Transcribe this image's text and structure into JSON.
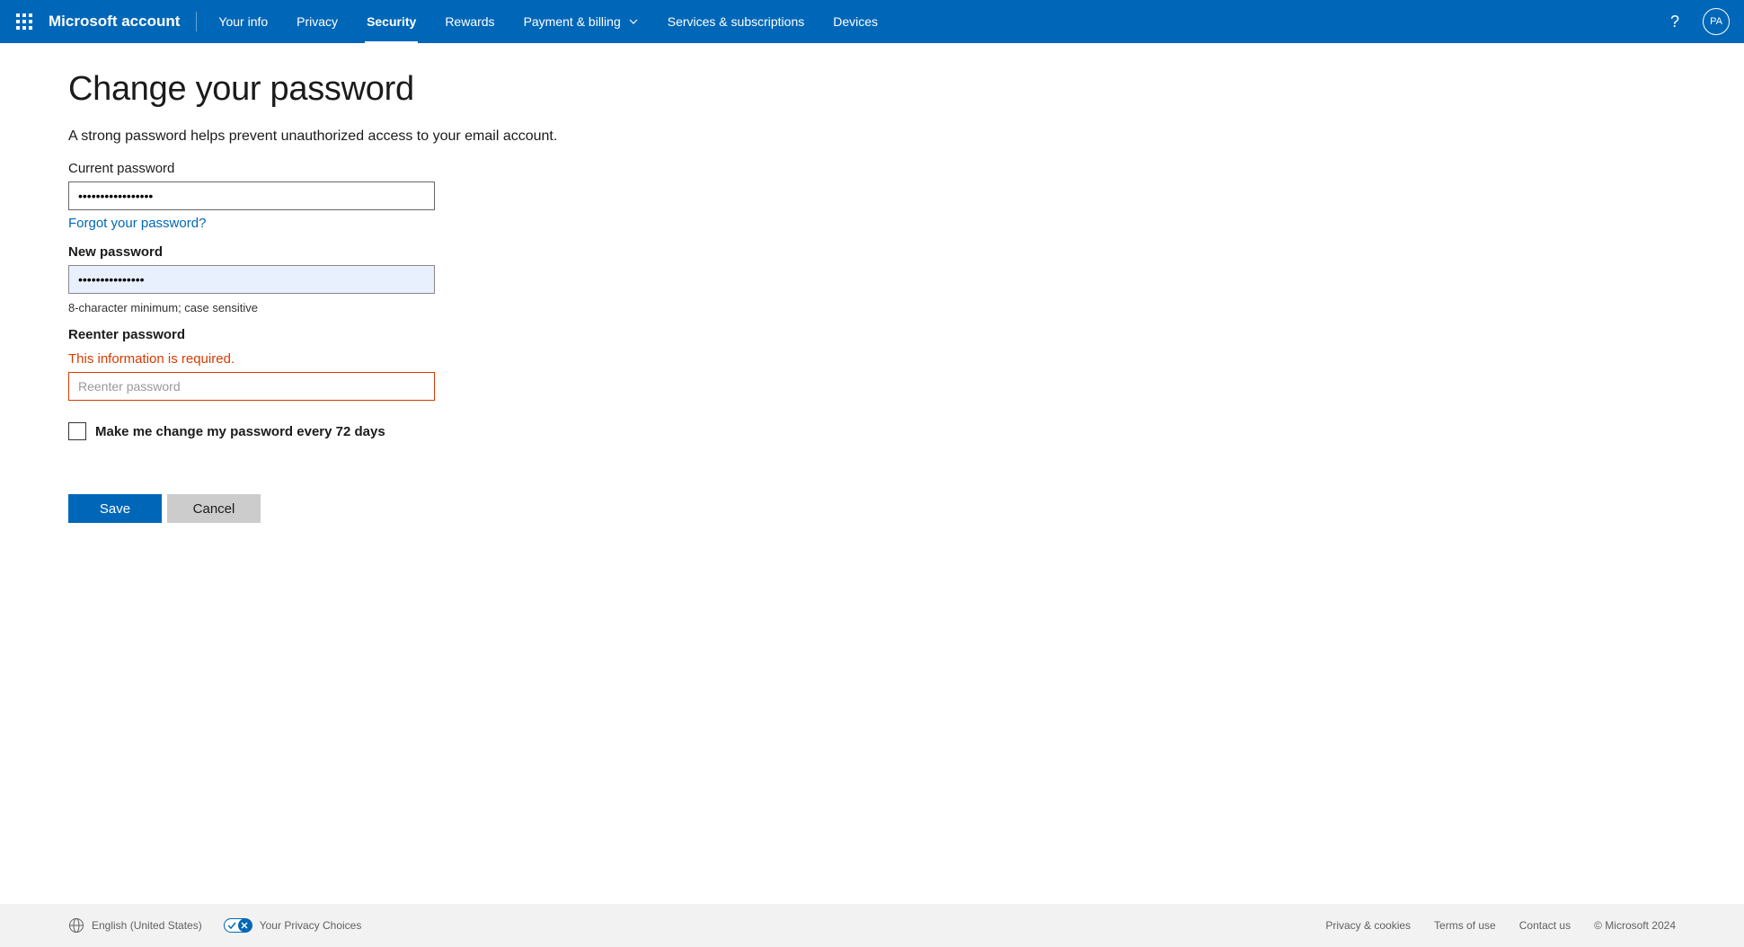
{
  "header": {
    "brand": "Microsoft account",
    "nav": [
      {
        "label": "Your info",
        "active": false,
        "hasDropdown": false
      },
      {
        "label": "Privacy",
        "active": false,
        "hasDropdown": false
      },
      {
        "label": "Security",
        "active": true,
        "hasDropdown": false
      },
      {
        "label": "Rewards",
        "active": false,
        "hasDropdown": false
      },
      {
        "label": "Payment & billing",
        "active": false,
        "hasDropdown": true
      },
      {
        "label": "Services & subscriptions",
        "active": false,
        "hasDropdown": false
      },
      {
        "label": "Devices",
        "active": false,
        "hasDropdown": false
      }
    ],
    "avatar_initials": "PA"
  },
  "page": {
    "title": "Change your password",
    "subtitle": "A strong password helps prevent unauthorized access to your email account.",
    "current_password": {
      "label": "Current password",
      "value": "•••••••••••••••••",
      "forgot_link": "Forgot your password?"
    },
    "new_password": {
      "label": "New password",
      "value": "•••••••••••••••",
      "hint": "8-character minimum; case sensitive"
    },
    "reenter_password": {
      "label": "Reenter password",
      "error": "This information is required.",
      "placeholder": "Reenter password",
      "value": ""
    },
    "change_every_72": {
      "label": "Make me change my password every 72 days",
      "checked": false
    },
    "save_label": "Save",
    "cancel_label": "Cancel"
  },
  "footer": {
    "language": "English (United States)",
    "privacy_choices": "Your Privacy Choices",
    "links": [
      "Privacy & cookies",
      "Terms of use",
      "Contact us"
    ],
    "copyright": "© Microsoft 2024"
  }
}
